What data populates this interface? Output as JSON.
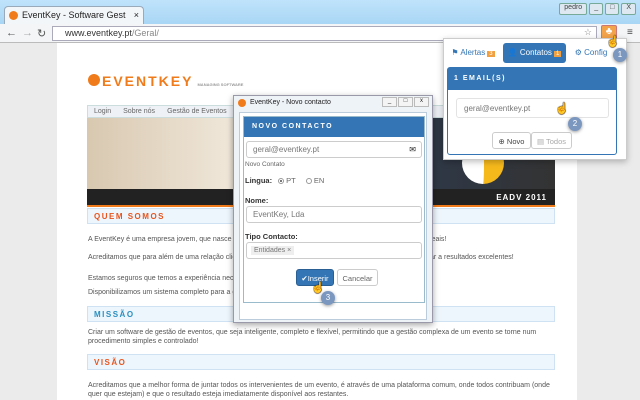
{
  "browser": {
    "tab_title": "EventKey - Software Gest",
    "url_host": "www.eventkey.pt",
    "url_path": "/Geral/",
    "user_label": "pedro",
    "window_controls": [
      "_",
      "□",
      "X"
    ]
  },
  "site": {
    "logo": "EVENTKEY",
    "logo_sub": "MANAGING SOFTWARE",
    "menu": [
      "Login",
      "Sobre nós",
      "Gestão de Eventos",
      "Ou",
      "mac"
    ],
    "hero_caption": "EADV 2011",
    "sections": [
      {
        "title": "Quem Somos",
        "color": "#e8541c",
        "paragraphs": [
          "A EventKey é uma empresa jovem, que nasce do ... mos no desenvolvimento de software para necessidades reais!",
          "Acreditamos que para além de uma relação cliente ... os intervenientes, pois só assim achamos possível chegar a resultados excelentes!",
          "Estamos seguros que temos a experiência necessária ... sua atividade.",
          "Disponibilizamos um sistema completo para a gestão"
        ]
      },
      {
        "title": "Missão",
        "color": "#2a8fc0",
        "paragraphs": [
          "Criar um software de gestão de eventos, que seja inteligente, completo e flexível, permitindo que a gestão complexa de um evento se torne num procedimento simples e controlado!"
        ]
      },
      {
        "title": "Visão",
        "color": "#e8541c",
        "paragraphs": [
          "Acreditamos que a melhor forma de juntar todos os intervenientes de um evento, é através de uma plataforma comum, onde todos contribuam (onde quer que estejam) e que o resultado esteja imediatamente disponível aos restantes."
        ]
      }
    ]
  },
  "dialog": {
    "title": "EventKey - Novo contacto",
    "header": "Novo Contacto",
    "email": "geral@eventkey.pt",
    "email_hint": "Novo Contato",
    "lingua_label": "Lingua:",
    "lingua_options": [
      "PT",
      "EN"
    ],
    "lingua_selected": "PT",
    "nome_label": "Nome:",
    "nome_value": "EventKey, Lda",
    "tipo_label": "Tipo Contacto:",
    "tipo_tag": "Entidades",
    "tag_remove": "×",
    "insert_label": "Inserir",
    "cancel_label": "Cancelar"
  },
  "popup": {
    "tabs": [
      {
        "label": "Alertas",
        "count": "3"
      },
      {
        "label": "Contatos",
        "count": "1"
      },
      {
        "label": "Config"
      }
    ],
    "active_tab": "Contatos",
    "header": "1 email(s)",
    "email": "geral@eventkey.pt",
    "new_label": "Novo",
    "all_label": "Todos"
  },
  "steps": [
    "1",
    "2",
    "3"
  ],
  "colors": {
    "accent": "#3476b5",
    "brand": "#f07b1b"
  }
}
